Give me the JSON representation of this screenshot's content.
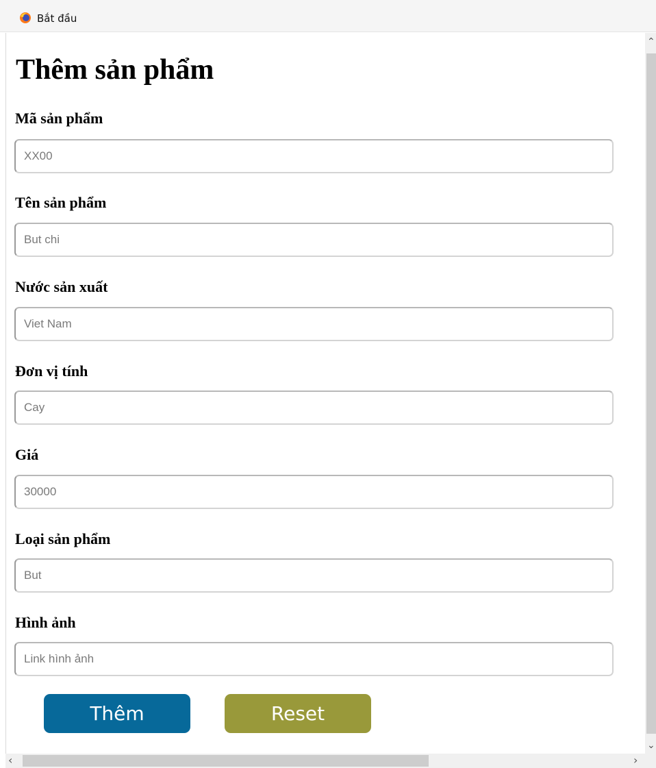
{
  "window": {
    "title": "Bắt đầu",
    "icon": "browser-icon"
  },
  "page": {
    "title": "Thêm sản phẩm"
  },
  "form": {
    "fields": [
      {
        "label": "Mã sản phẩm",
        "placeholder": "XX00"
      },
      {
        "label": "Tên sản phẩm",
        "placeholder": "But chi"
      },
      {
        "label": "Nước sản xuất",
        "placeholder": "Viet Nam"
      },
      {
        "label": "Đơn vị tính",
        "placeholder": "Cay"
      },
      {
        "label": "Giá",
        "placeholder": "30000"
      },
      {
        "label": "Loại sản phẩm",
        "placeholder": "But"
      },
      {
        "label": "Hình ảnh",
        "placeholder": "Link hình ảnh"
      }
    ],
    "add_label": "Thêm",
    "reset_label": "Reset"
  },
  "colors": {
    "add_button": "#07699a",
    "reset_button": "#99993a"
  },
  "scrollbars": {
    "vertical_up": "⌃",
    "vertical_down": "⌄",
    "horizontal_left": "‹",
    "horizontal_right": "›"
  }
}
